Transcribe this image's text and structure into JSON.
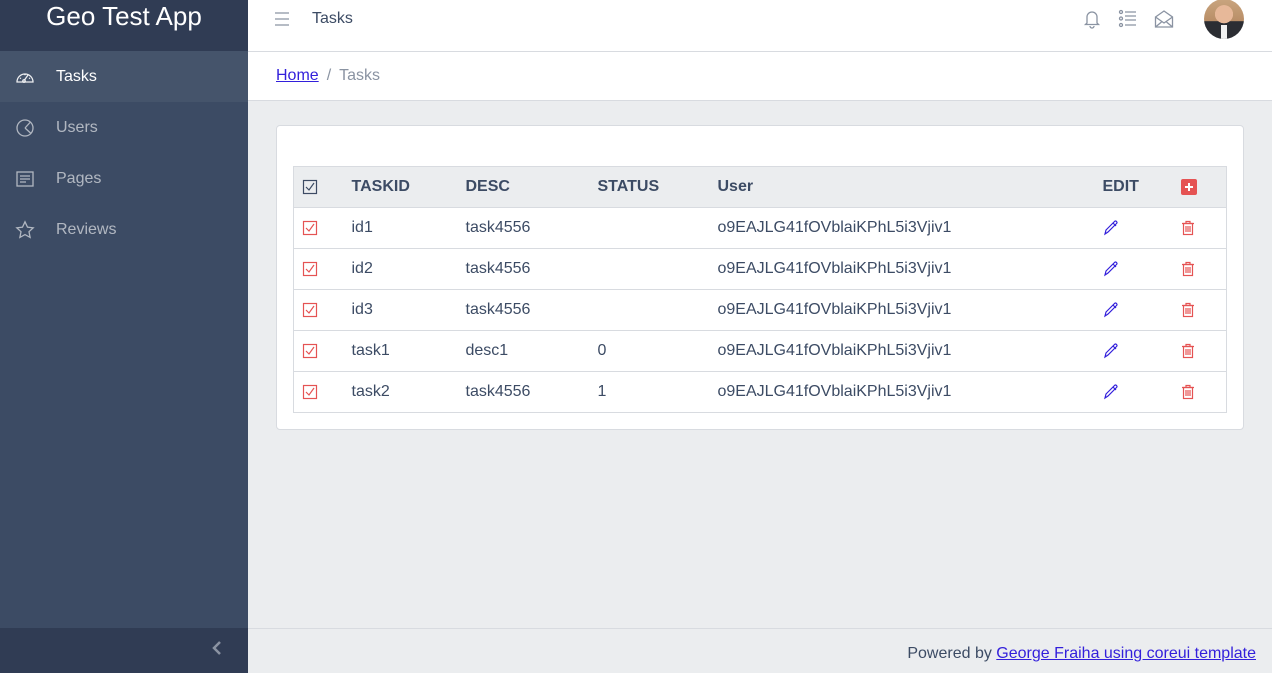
{
  "app": {
    "brand": "Geo Test App"
  },
  "sidebar": {
    "items": [
      {
        "label": "Tasks",
        "icon": "speedometer-icon",
        "active": true
      },
      {
        "label": "Users",
        "icon": "chart-pie-icon",
        "active": false
      },
      {
        "label": "Pages",
        "icon": "notes-icon",
        "active": false
      },
      {
        "label": "Reviews",
        "icon": "star-icon",
        "active": false
      }
    ],
    "minimizer_icon": "chevron-left-icon"
  },
  "header": {
    "title": "Tasks",
    "icons": [
      "bell-icon",
      "list-icon",
      "envelope-open-icon"
    ],
    "avatar": "user-avatar"
  },
  "breadcrumb": {
    "home": "Home",
    "separator": "/",
    "current": "Tasks"
  },
  "table": {
    "columns": [
      "TASKID",
      "DESC",
      "STATUS",
      "User",
      "EDIT"
    ],
    "rows": [
      {
        "taskid": "id1",
        "desc": "task4556",
        "status": "",
        "user": "o9EAJLG41fOVblaiKPhL5i3Vjiv1"
      },
      {
        "taskid": "id2",
        "desc": "task4556",
        "status": "",
        "user": "o9EAJLG41fOVblaiKPhL5i3Vjiv1"
      },
      {
        "taskid": "id3",
        "desc": "task4556",
        "status": "",
        "user": "o9EAJLG41fOVblaiKPhL5i3Vjiv1"
      },
      {
        "taskid": "task1",
        "desc": "desc1",
        "status": "0",
        "user": "o9EAJLG41fOVblaiKPhL5i3Vjiv1"
      },
      {
        "taskid": "task2",
        "desc": "task4556",
        "status": "1",
        "user": "o9EAJLG41fOVblaiKPhL5i3Vjiv1"
      }
    ]
  },
  "footer": {
    "prefix": "Powered by",
    "link": "George Fraiha using coreui template"
  },
  "colors": {
    "sidebar": "#3c4b64",
    "sidebar_dark": "#303c54",
    "primary": "#321fdb",
    "danger": "#e55353",
    "body": "#ebedef"
  }
}
